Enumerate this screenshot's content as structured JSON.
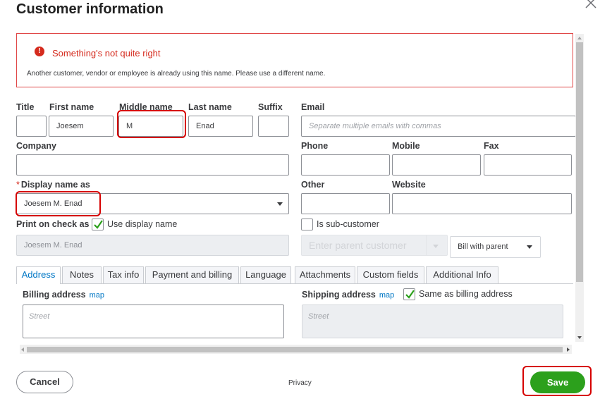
{
  "dialog": {
    "title": "Customer information"
  },
  "error": {
    "title": "Something's not quite right",
    "message": "Another customer, vendor or employee is already using this name. Please use a different name."
  },
  "fields": {
    "title_label": "Title",
    "first_name_label": "First name",
    "first_name_value": "Joesem",
    "middle_name_label": "Middle name",
    "middle_name_value": "M",
    "last_name_label": "Last name",
    "last_name_value": "Enad",
    "suffix_label": "Suffix",
    "email_label": "Email",
    "email_placeholder": "Separate multiple emails with commas",
    "company_label": "Company",
    "phone_label": "Phone",
    "mobile_label": "Mobile",
    "fax_label": "Fax",
    "display_name_required": "*",
    "display_name_label": "Display name as",
    "display_name_value": "Joesem M. Enad",
    "other_label": "Other",
    "website_label": "Website",
    "print_on_check_label": "Print on check as",
    "use_display_name_label": "Use display name",
    "print_on_check_value": "Joesem M. Enad",
    "sub_customer_label": "Is sub-customer",
    "parent_customer_placeholder": "Enter parent customer",
    "bill_with_parent": "Bill with parent"
  },
  "tabs": [
    "Address",
    "Notes",
    "Tax info",
    "Payment and billing",
    "Language",
    "Attachments",
    "Custom fields",
    "Additional Info"
  ],
  "address": {
    "billing_label": "Billing address",
    "billing_map": "map",
    "shipping_label": "Shipping address",
    "shipping_map": "map",
    "same_as_billing": "Same as billing address",
    "street_placeholder": "Street"
  },
  "footer": {
    "cancel": "Cancel",
    "privacy": "Privacy",
    "save": "Save"
  },
  "colors": {
    "accent_green": "#2ca01c",
    "error_red": "#d52b1e",
    "link_blue": "#0077c5",
    "highlight_red": "#d60000"
  }
}
